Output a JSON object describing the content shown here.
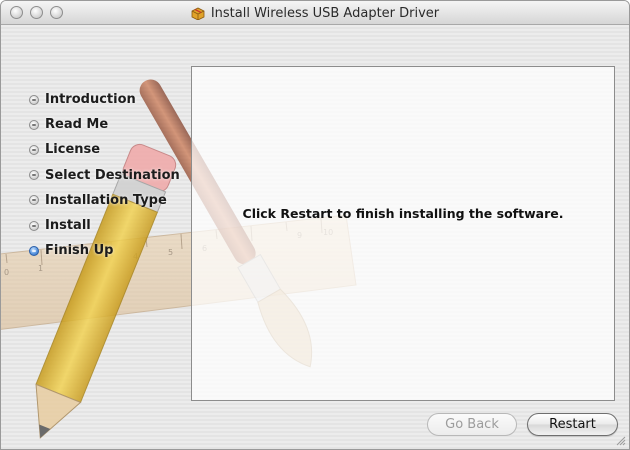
{
  "window": {
    "title": "Install Wireless USB Adapter Driver",
    "title_icon": "package-icon"
  },
  "steps": [
    {
      "label": "Introduction",
      "state": "done"
    },
    {
      "label": "Read Me",
      "state": "done"
    },
    {
      "label": "License",
      "state": "done"
    },
    {
      "label": "Select Destination",
      "state": "done"
    },
    {
      "label": "Installation Type",
      "state": "done"
    },
    {
      "label": "Install",
      "state": "done"
    },
    {
      "label": "Finish Up",
      "state": "current"
    }
  ],
  "content": {
    "message": "Click Restart to finish installing the software."
  },
  "buttons": {
    "go_back": "Go Back",
    "restart": "Restart"
  },
  "colors": {
    "active_step": "#2a63b8",
    "window_bg": "#e9e9e9"
  }
}
